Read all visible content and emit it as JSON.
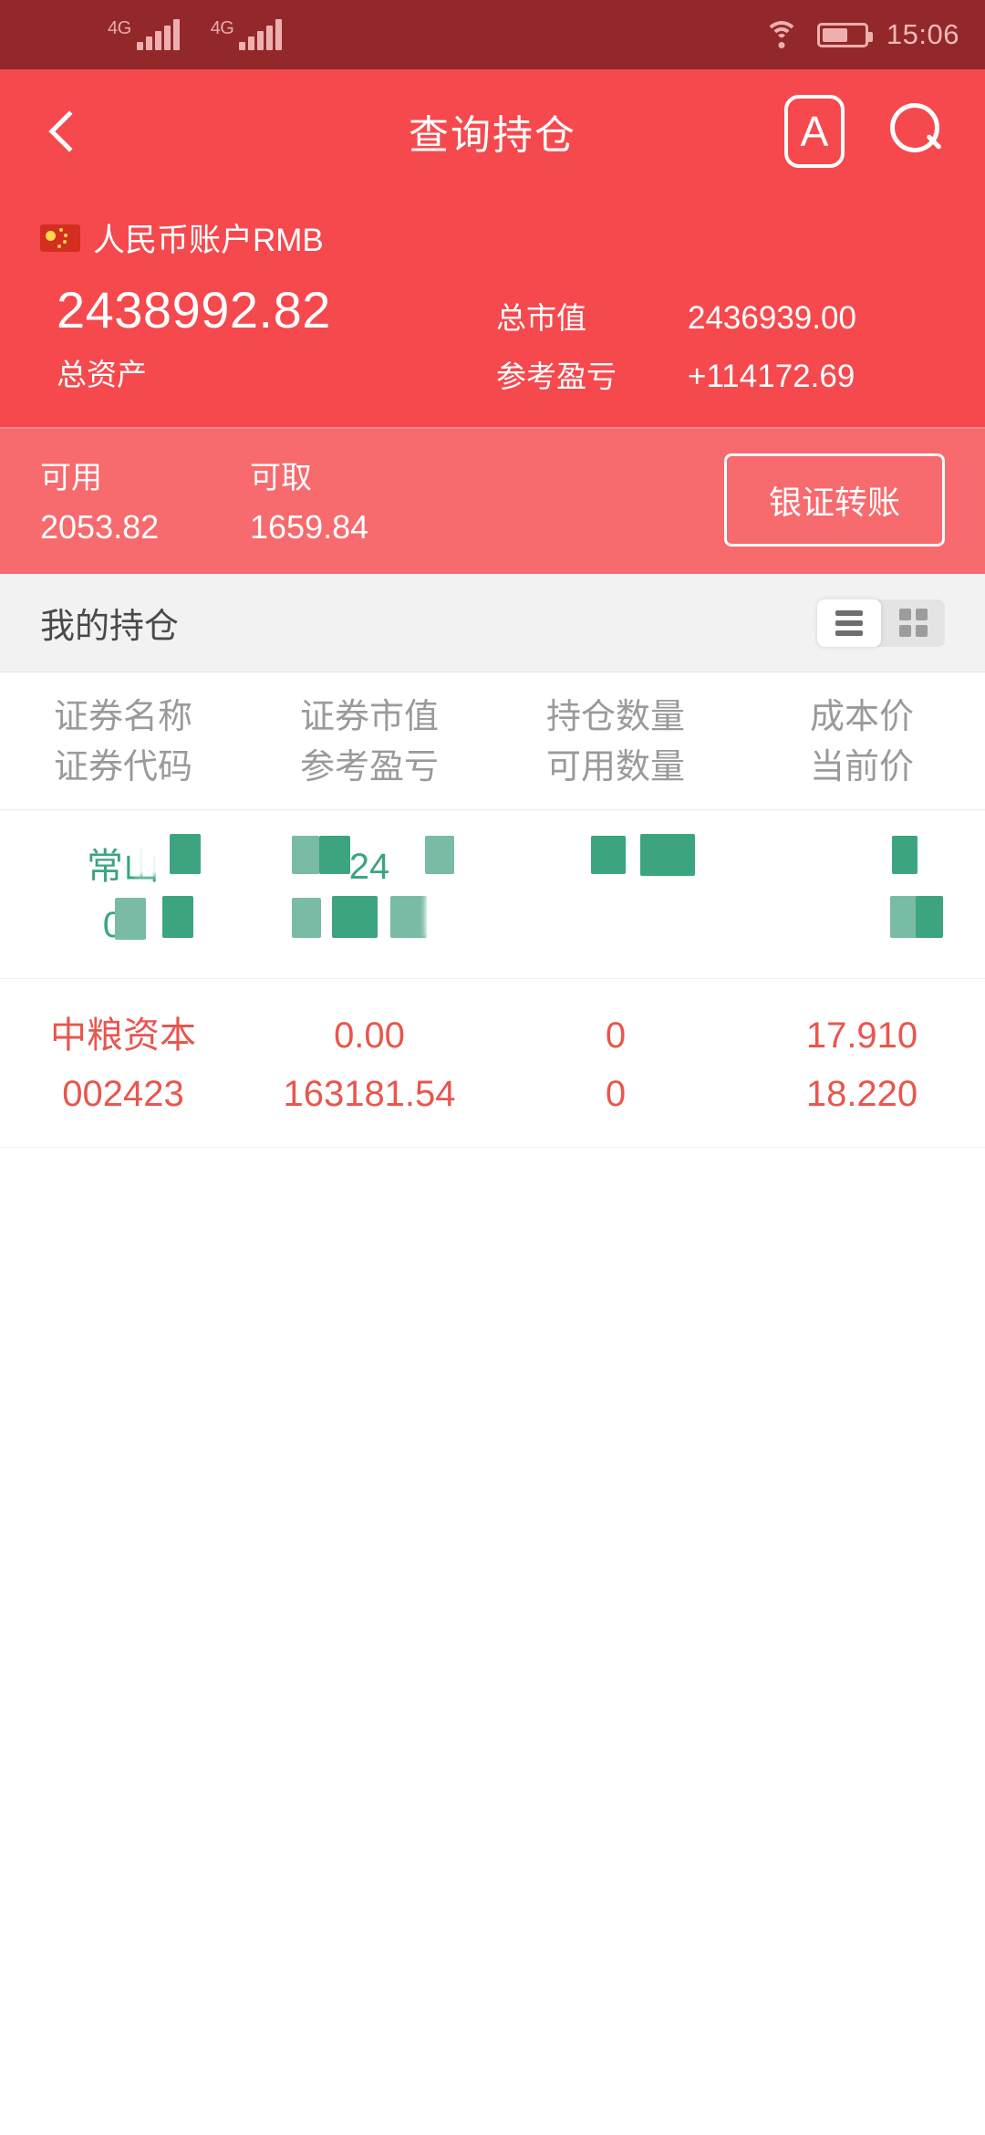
{
  "status_bar": {
    "sim1_network": "4G",
    "sim2_network": "4G",
    "time": "15:06",
    "wifi_icon": "wifi-icon",
    "battery_icon": "battery-icon",
    "battery_level_percent": 62
  },
  "nav": {
    "back_icon": "back-chevron-icon",
    "title": "查询持仓",
    "font_size_icon_label": "A",
    "search_icon": "search-icon"
  },
  "account": {
    "flag_icon": "china-flag-icon",
    "name": "人民币账户RMB",
    "total_assets_value": "2438992.82",
    "total_assets_label": "总资产",
    "market_value_label": "总市值",
    "market_value": "2436939.00",
    "pnl_label": "参考盈亏",
    "pnl_value": "+114172.69"
  },
  "funds": {
    "available_label": "可用",
    "available_value": "2053.82",
    "withdrawable_label": "可取",
    "withdrawable_value": "1659.84",
    "transfer_button": "银证转账"
  },
  "holdings_section": {
    "title": "我的持仓",
    "view_list_icon": "list-view-icon",
    "view_grid_icon": "grid-view-icon",
    "active_view": "list"
  },
  "table": {
    "headers": [
      {
        "line1": "证券名称",
        "line2": "证券代码"
      },
      {
        "line1": "证券市值",
        "line2": "参考盈亏"
      },
      {
        "line1": "持仓数量",
        "line2": "可用数量"
      },
      {
        "line1": "成本价",
        "line2": "当前价"
      }
    ],
    "rows": [
      {
        "color": "green",
        "redacted": true,
        "name": "常山",
        "code": "00",
        "market_value": "24",
        "pnl": "",
        "quantity": "",
        "available_quantity": "",
        "cost_price": "",
        "current_price": ""
      },
      {
        "color": "red",
        "redacted": false,
        "name": "中粮资本",
        "code": "002423",
        "market_value": "0.00",
        "pnl": "163181.54",
        "quantity": "0",
        "available_quantity": "0",
        "cost_price": "17.910",
        "current_price": "18.220"
      }
    ]
  },
  "colors": {
    "status_bar": "#92282A",
    "header_red": "#F5494E",
    "funds_red": "#F76A6D",
    "section_grey": "#F2F2F2",
    "row_green": "#3CA57F",
    "row_red": "#E8564E"
  }
}
